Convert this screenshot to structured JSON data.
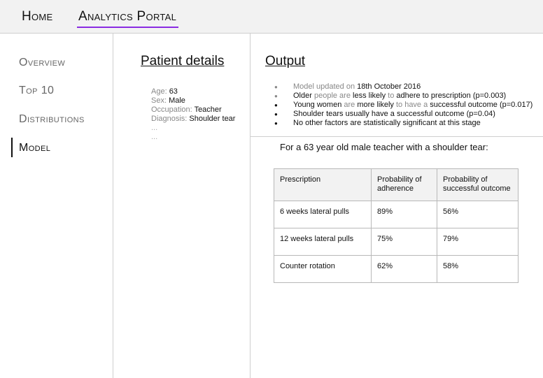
{
  "header": {
    "nav": [
      {
        "label": "Home"
      },
      {
        "label": "Analytics Portal"
      }
    ]
  },
  "sidebar": {
    "items": [
      {
        "label": "Overview"
      },
      {
        "label": "Top 10"
      },
      {
        "label": "Distributions"
      },
      {
        "label": "Model"
      }
    ]
  },
  "patient": {
    "title": "Patient details",
    "fields": [
      {
        "label": "Age: ",
        "value": "63"
      },
      {
        "label": "Sex: ",
        "value": "Male"
      },
      {
        "label": "Occupation:  ",
        "value": "Teacher"
      },
      {
        "label": "Diagnosis: ",
        "value": "Shoulder tear"
      }
    ],
    "more": [
      "...",
      "..."
    ]
  },
  "output": {
    "title": "Output",
    "findings": [
      {
        "parts": [
          {
            "t": "Model updated on ",
            "g": true
          },
          {
            "t": "18th October 2016"
          }
        ]
      },
      {
        "parts": [
          {
            "t": "Older "
          },
          {
            "t": "people are ",
            "g": true
          },
          {
            "t": "less likely "
          },
          {
            "t": "to ",
            "g": true
          },
          {
            "t": "adhere to prescription (p=0.003)"
          }
        ]
      },
      {
        "parts": [
          {
            "t": "Young women "
          },
          {
            "t": "are ",
            "g": true
          },
          {
            "t": "more likely "
          },
          {
            "t": "to have a ",
            "g": true
          },
          {
            "t": "successful outcome (p=0.017)"
          }
        ]
      },
      {
        "parts": [
          {
            "t": "Shoulder tears usually have a successful outcome (p=0.04)"
          }
        ]
      },
      {
        "parts": [
          {
            "t": "No other factors are statistically significant at this stage"
          }
        ]
      }
    ],
    "scenario": "For a 63 year old male teacher with a shoulder tear:",
    "table": {
      "headers": [
        "Prescription",
        "Probability of adherence",
        "Probability of successful outcome"
      ],
      "rows": [
        [
          "6 weeks lateral pulls",
          "89%",
          "56%"
        ],
        [
          "12 weeks lateral pulls",
          "75%",
          "79%"
        ],
        [
          "Counter rotation",
          "62%",
          "58%"
        ]
      ]
    }
  },
  "colors": {
    "accent": "#8a2be2",
    "header_bg": "#f2f2f2",
    "muted_text": "#888888",
    "border": "#cfcfcf"
  }
}
